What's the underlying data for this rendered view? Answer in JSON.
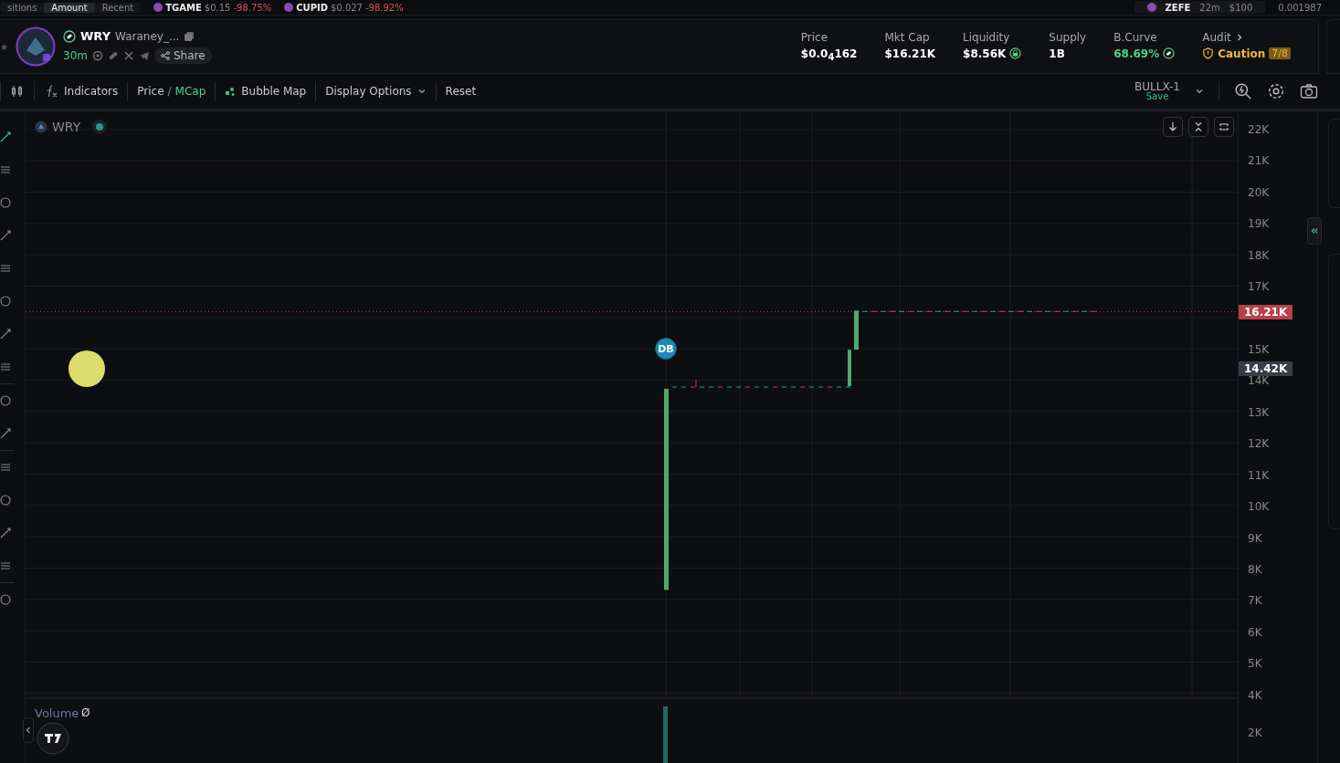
{
  "top_strip": {
    "tabs": [
      {
        "label": "sitions",
        "selected": false
      },
      {
        "label": "Amount",
        "selected": true
      },
      {
        "label": "Recent",
        "selected": false
      }
    ],
    "tickers": [
      {
        "symbol": "TGAME",
        "price": "$0.15",
        "change": "-98.75%"
      },
      {
        "symbol": "CUPID",
        "price": "$0.027",
        "change": "-98.92%"
      }
    ],
    "wallet": {
      "symbol": "ZEFE",
      "age": "22m",
      "amount": "$100"
    },
    "balance": "0.001987"
  },
  "token": {
    "symbol": "WRY",
    "name": "Waraney_...",
    "age": "30m",
    "share": "Share"
  },
  "stats": [
    {
      "label": "Price",
      "value": "$0.0$_{4}$162",
      "kind": "plain"
    },
    {
      "label": "Mkt Cap",
      "value": "$16.21K",
      "kind": "plain"
    },
    {
      "label": "Liquidity",
      "value": "$8.56K",
      "kind": "locked"
    },
    {
      "label": "Supply",
      "value": "1B",
      "kind": "plain"
    },
    {
      "label": "B.Curve",
      "value": "68.69%",
      "kind": "curve"
    }
  ],
  "audit": {
    "label": "Audit",
    "status": "Caution",
    "score": "7/8"
  },
  "toolbar": {
    "indicators": "Indicators",
    "price_mode": [
      {
        "label": "Price",
        "selected": false
      },
      {
        "label": "MCap",
        "selected": true
      }
    ],
    "separator": "/",
    "bubble_map": "Bubble Map",
    "display_options": "Display Options",
    "reset": "Reset",
    "layout_name": "BULLX-1",
    "layout_status": "Save"
  },
  "chart": {
    "legend": "WRY",
    "marker": "DB",
    "price_axis_upper": [
      "22K",
      "21K",
      "20K",
      "19K",
      "18K",
      "17K"
    ],
    "price_axis_lower": [
      "15K",
      "14K",
      "13K",
      "12K",
      "11K",
      "10K",
      "9K",
      "8K",
      "7K",
      "6K",
      "5K",
      "4K"
    ],
    "last_price": "16.21K",
    "cursor_price": "14.42K",
    "volume": {
      "label": "Volume",
      "value": "Ø",
      "axis": [
        "2K"
      ]
    }
  }
}
